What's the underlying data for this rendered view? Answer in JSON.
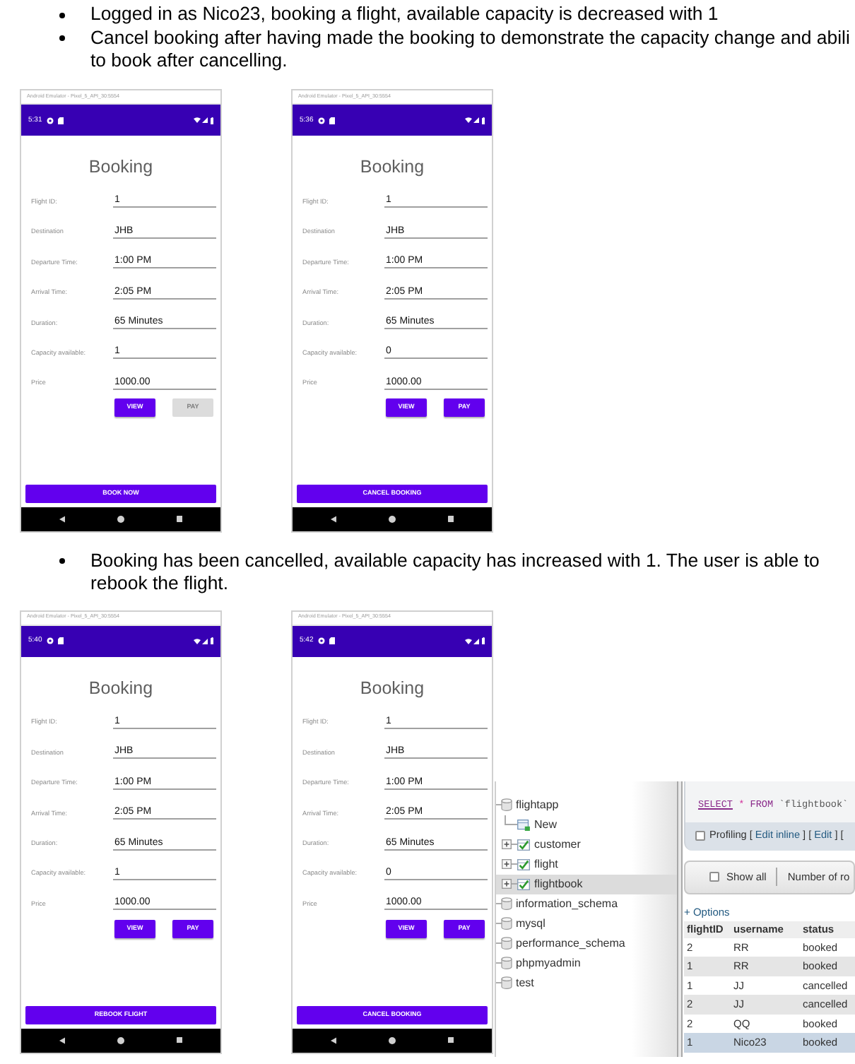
{
  "sections": [
    {
      "bullets": [
        {
          "lines": [
            "Logged in as Nico23, booking a flight, available capacity is decreased with 1"
          ]
        },
        {
          "lines": [
            "Cancel booking after having made the booking to demonstrate the capacity change and abili",
            "to book after cancelling."
          ]
        }
      ],
      "phones": [
        {
          "emulator_title": "Android Emulator - Pixel_5_API_30:5554",
          "time": "5:31",
          "heading": "Booking",
          "fields": [
            {
              "label": "Flight ID:",
              "value": "1"
            },
            {
              "label": "Destination",
              "value": "JHB"
            },
            {
              "label": "Departure Time:",
              "value": "1:00 PM"
            },
            {
              "label": "Arrival Time:",
              "value": "2:05 PM"
            },
            {
              "label": "Duration:",
              "value": "65 Minutes"
            },
            {
              "label": "Capacity available:",
              "value": "1"
            },
            {
              "label": "Price",
              "value": "1000.00"
            }
          ],
          "buttons": [
            {
              "label": "VIEW",
              "disabled": false
            },
            {
              "label": "PAY",
              "disabled": true
            }
          ],
          "action_button": "BOOK NOW"
        },
        {
          "emulator_title": "Android Emulator - Pixel_5_API_30:5554",
          "time": "5:36",
          "heading": "Booking",
          "fields": [
            {
              "label": "Flight ID:",
              "value": "1"
            },
            {
              "label": "Destination",
              "value": "JHB"
            },
            {
              "label": "Departure Time:",
              "value": "1:00 PM"
            },
            {
              "label": "Arrival Time:",
              "value": "2:05 PM"
            },
            {
              "label": "Duration:",
              "value": "65 Minutes"
            },
            {
              "label": "Capacity available:",
              "value": "0"
            },
            {
              "label": "Price",
              "value": "1000.00"
            }
          ],
          "buttons": [
            {
              "label": "VIEW",
              "disabled": false
            },
            {
              "label": "PAY",
              "disabled": false
            }
          ],
          "action_button": "CANCEL BOOKING"
        }
      ]
    },
    {
      "bullets": [
        {
          "lines": [
            "Booking has been cancelled, available capacity has increased with 1. The user is able to",
            "rebook the flight."
          ]
        }
      ],
      "phones": [
        {
          "emulator_title": "Android Emulator - Pixel_5_API_30:5554",
          "time": "5:40",
          "heading": "Booking",
          "fields": [
            {
              "label": "Flight ID:",
              "value": "1"
            },
            {
              "label": "Destination",
              "value": "JHB"
            },
            {
              "label": "Departure Time:",
              "value": "1:00 PM"
            },
            {
              "label": "Arrival Time:",
              "value": "2:05 PM"
            },
            {
              "label": "Duration:",
              "value": "65 Minutes"
            },
            {
              "label": "Capacity available:",
              "value": "1"
            },
            {
              "label": "Price",
              "value": "1000.00"
            }
          ],
          "buttons": [
            {
              "label": "VIEW",
              "disabled": false
            },
            {
              "label": "PAY",
              "disabled": false
            }
          ],
          "action_button": "REBOOK FLIGHT"
        },
        {
          "emulator_title": "Android Emulator - Pixel_5_API_30:5554",
          "time": "5:42",
          "heading": "Booking",
          "fields": [
            {
              "label": "Flight ID:",
              "value": "1"
            },
            {
              "label": "Destination",
              "value": "JHB"
            },
            {
              "label": "Departure Time:",
              "value": "1:00 PM"
            },
            {
              "label": "Arrival Time:",
              "value": "2:05 PM"
            },
            {
              "label": "Duration:",
              "value": "65 Minutes"
            },
            {
              "label": "Capacity available:",
              "value": "0"
            },
            {
              "label": "Price",
              "value": "1000.00"
            }
          ],
          "buttons": [
            {
              "label": "VIEW",
              "disabled": false
            },
            {
              "label": "PAY",
              "disabled": false
            }
          ],
          "action_button": "CANCEL BOOKING"
        }
      ],
      "phpmyadmin": {
        "tree": [
          {
            "label": "flightapp",
            "kind": "database",
            "selected": false,
            "children": [
              {
                "label": "New",
                "kind": "new",
                "selected": false
              },
              {
                "label": "customer",
                "kind": "table",
                "selected": false,
                "expanded": false
              },
              {
                "label": "flight",
                "kind": "table",
                "selected": false,
                "expanded": false
              },
              {
                "label": "flightbook",
                "kind": "table",
                "selected": true,
                "expanded": false
              }
            ]
          },
          {
            "label": "information_schema",
            "kind": "database",
            "selected": false
          },
          {
            "label": "mysql",
            "kind": "database",
            "selected": false
          },
          {
            "label": "performance_schema",
            "kind": "database",
            "selected": false
          },
          {
            "label": "phpmyadmin",
            "kind": "database",
            "selected": false
          },
          {
            "label": "test",
            "kind": "database",
            "selected": false
          }
        ],
        "query": [
          {
            "text": "SELECT",
            "kind": "keyword_link"
          },
          {
            "text": "*",
            "kind": "symbol"
          },
          {
            "text": "FROM",
            "kind": "keyword"
          },
          {
            "text": "`flightbook`",
            "kind": "identifier"
          }
        ],
        "profiling": {
          "checkbox": {
            "label": "Profiling",
            "checked": false
          },
          "parts": [
            {
              "text": "[",
              "kind": "bracket"
            },
            {
              "text": "Edit inline",
              "kind": "link"
            },
            {
              "text": "]",
              "kind": "bracket"
            },
            {
              "text": "[",
              "kind": "bracket"
            },
            {
              "text": "Edit",
              "kind": "link"
            },
            {
              "text": "]",
              "kind": "bracket"
            },
            {
              "text": "[",
              "kind": "bracket"
            }
          ]
        },
        "show_all": {
          "label": "Show all",
          "checked": false
        },
        "rows_label": "Number of ro",
        "options_link": "+ Options",
        "table": {
          "columns": [
            "flightID",
            "username",
            "status"
          ],
          "rows": [
            {
              "cells": [
                "2",
                "RR",
                "booked"
              ],
              "selected": false
            },
            {
              "cells": [
                "1",
                "RR",
                "booked"
              ],
              "selected": false
            },
            {
              "cells": [
                "1",
                "JJ",
                "cancelled"
              ],
              "selected": false
            },
            {
              "cells": [
                "2",
                "JJ",
                "cancelled"
              ],
              "selected": false
            },
            {
              "cells": [
                "2",
                "QQ",
                "booked"
              ],
              "selected": false
            },
            {
              "cells": [
                "1",
                "Nico23",
                "booked"
              ],
              "selected": true
            }
          ]
        }
      }
    }
  ]
}
